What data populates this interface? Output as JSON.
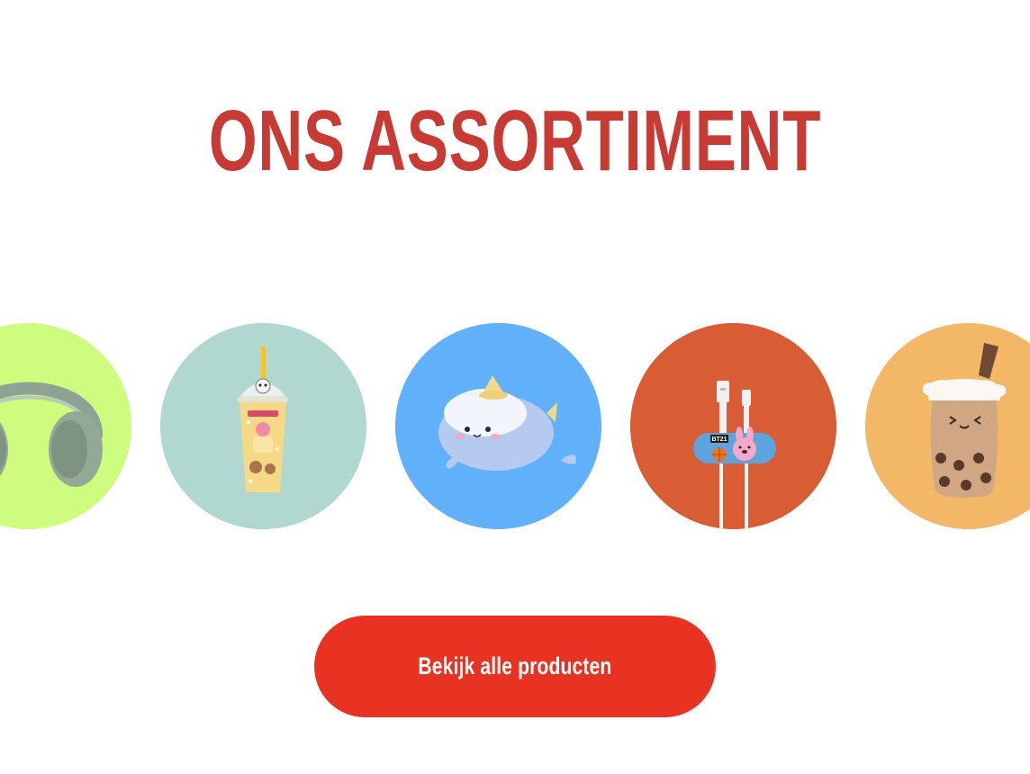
{
  "heading": {
    "title": "ONS ASSORTIMENT",
    "color": "#c83a34"
  },
  "categories": [
    {
      "icon": "headphones-icon",
      "bg": "#cdfc7e"
    },
    {
      "icon": "cup-icon",
      "bg": "#b0d8d1"
    },
    {
      "icon": "plush-icon",
      "bg": "#60b1fa"
    },
    {
      "icon": "cable-holder-icon",
      "bg": "#d85d35"
    },
    {
      "icon": "bubble-tea-plush-icon",
      "bg": "#f2b868"
    }
  ],
  "cta": {
    "label": "Bekijk alle producten",
    "color": "#e83222"
  },
  "cable_holder": {
    "badge": "BT21"
  }
}
